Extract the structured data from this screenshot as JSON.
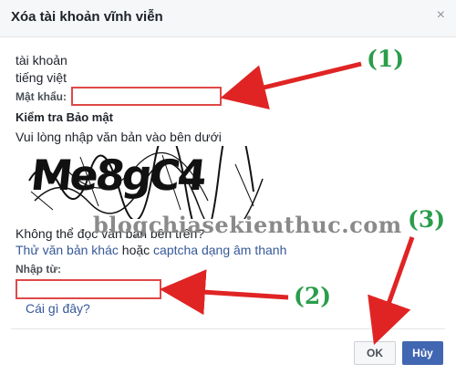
{
  "dialog": {
    "title": "Xóa tài khoản vĩnh viễn",
    "close_label": "×"
  },
  "account": {
    "line1": "tài khoản",
    "line2": "tiếng việt"
  },
  "password": {
    "label": "Mật khẩu:",
    "value": ""
  },
  "security": {
    "heading": "Kiểm tra Bảo mật",
    "instruction": "Vui lòng nhập văn bản vào bên dưới",
    "captcha_text": "Me8gC4",
    "cant_read": "Không thể đọc văn bản bên trên?",
    "try_other": "Thử văn bản khác",
    "or": "hoặc",
    "audio": "captcha dạng âm thanh",
    "input_label": "Nhập từ:",
    "input_value": "",
    "whats_this": "Cái gì đây?"
  },
  "buttons": {
    "ok": "OK",
    "cancel": "Hủy"
  },
  "annotations": {
    "step1": "(1)",
    "step2": "(2)",
    "step3": "(3)",
    "watermark": "blogchiasekienthuc.com",
    "arrow_color": "#e02424",
    "step_color": "#2a9d4b"
  }
}
